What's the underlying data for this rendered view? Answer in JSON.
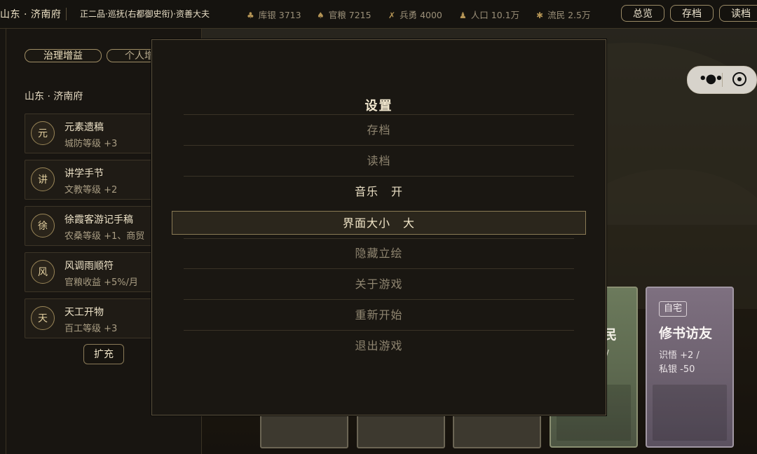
{
  "header": {
    "region": "山东 · 济南府",
    "rank": "正二品·巡抚(右都御史衔)·资善大夫",
    "resources": [
      {
        "icon": "silver-icon",
        "label": "库银",
        "value": "3713"
      },
      {
        "icon": "grain-icon",
        "label": "官粮",
        "value": "7215"
      },
      {
        "icon": "soldier-icon",
        "label": "兵勇",
        "value": "4000"
      },
      {
        "icon": "population-icon",
        "label": "人口",
        "value": "10.1万"
      },
      {
        "icon": "refugee-icon",
        "label": "流民",
        "value": "2.5万"
      }
    ],
    "buttons": {
      "overview": "总览",
      "save": "存档",
      "load": "读档"
    }
  },
  "leftpanel": {
    "tabs": {
      "governance": "治理增益",
      "personal": "个人增"
    },
    "region": "山东 · 济南府",
    "items": [
      {
        "badge": "元",
        "name": "元素遗稿",
        "effect": "城防等级 +3"
      },
      {
        "badge": "讲",
        "name": "讲学手节",
        "effect": "文教等级 +2"
      },
      {
        "badge": "徐",
        "name": "徐霞客游记手稿",
        "effect": "农桑等级 +1、商贸"
      },
      {
        "badge": "风",
        "name": "风调雨顺符",
        "effect": "官粮收益 +5%/月"
      },
      {
        "badge": "天",
        "name": "天工开物",
        "effect": "百工等级 +3"
      }
    ],
    "expand": "扩充"
  },
  "cards": {
    "green": {
      "title": "民",
      "effect1": "0 /",
      "effect2": "/"
    },
    "purple": {
      "tag": "自宅",
      "title": "修书访友",
      "effect1": "识悟 +2 /",
      "effect2": "私银 -50"
    }
  },
  "settings": {
    "title": "设置",
    "items": [
      {
        "label": "存档",
        "value": ""
      },
      {
        "label": "读档",
        "value": ""
      },
      {
        "label": "音乐",
        "value": "开"
      },
      {
        "label": "界面大小",
        "value": "大"
      },
      {
        "label": "隐藏立绘",
        "value": ""
      },
      {
        "label": "关于游戏",
        "value": ""
      },
      {
        "label": "重新开始",
        "value": ""
      },
      {
        "label": "退出游戏",
        "value": ""
      }
    ]
  }
}
